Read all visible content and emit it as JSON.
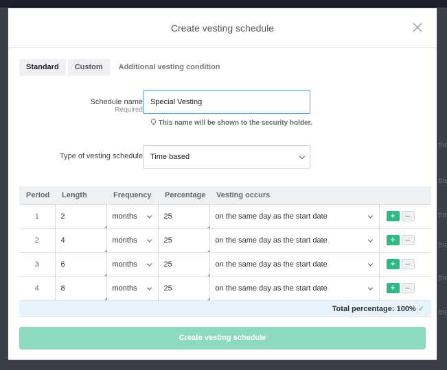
{
  "backdrop": {
    "text": "the"
  },
  "modal": {
    "title": "Create vesting schedule"
  },
  "tabs": [
    {
      "label": "Standard"
    },
    {
      "label": "Custom"
    },
    {
      "label": "Additional vesting condition"
    }
  ],
  "form": {
    "schedule_name_label": "Schedule name",
    "required_label": "Required",
    "schedule_name_value": "Special Vesting",
    "hint": "This name will be shown to the security holder.",
    "type_label": "Type of vesting schedule",
    "type_value": "Time based"
  },
  "table": {
    "headers": [
      "Period",
      "Length",
      "Frequency",
      "Percentage",
      "Vesting occurs"
    ],
    "rows": [
      {
        "period": "1",
        "length": "2",
        "frequency": "months",
        "percentage": "25",
        "occurs": "on the same day as the start date"
      },
      {
        "period": "2",
        "length": "4",
        "frequency": "months",
        "percentage": "25",
        "occurs": "on the same day as the start date"
      },
      {
        "period": "3",
        "length": "6",
        "frequency": "months",
        "percentage": "25",
        "occurs": "on the same day as the start date"
      },
      {
        "period": "4",
        "length": "8",
        "frequency": "months",
        "percentage": "25",
        "occurs": "on the same day as the start date"
      }
    ],
    "total": "Total percentage: 100%",
    "add": "+",
    "remove": "−"
  },
  "submit": "Create vesting schedule",
  "colors": {
    "accent": "#2fb985",
    "submit_disabled": "#8fd9c2",
    "focus": "#4a9be0"
  }
}
